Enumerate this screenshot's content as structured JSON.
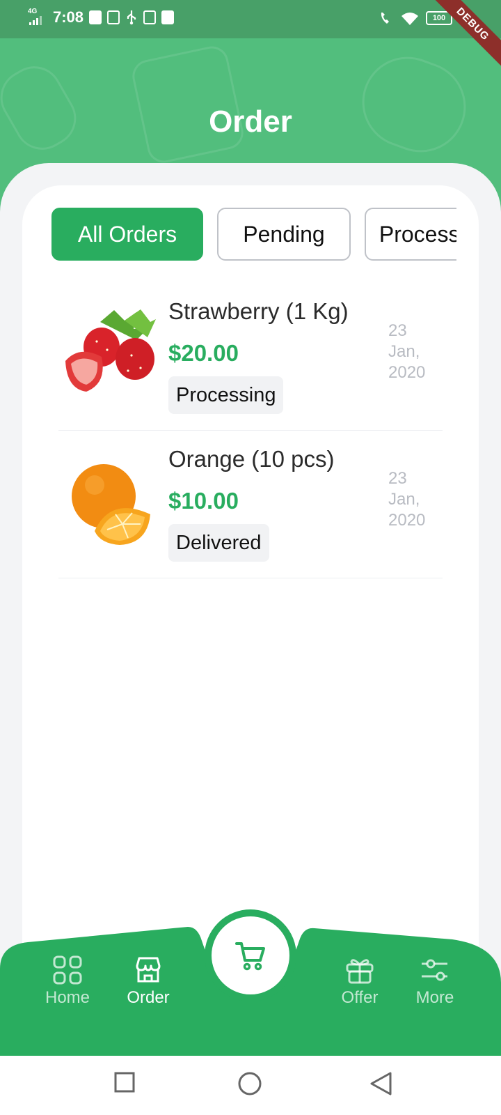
{
  "status_bar": {
    "network": "4G",
    "time": "7:08",
    "battery": "100",
    "debug_label": "DEBUG"
  },
  "header": {
    "title": "Order"
  },
  "tabs": [
    {
      "label": "All Orders",
      "active": true
    },
    {
      "label": "Pending",
      "active": false
    },
    {
      "label": "Processing",
      "active": false
    }
  ],
  "orders": [
    {
      "name": "Strawberry (1 Kg)",
      "price": "$20.00",
      "status": "Processing",
      "date": "23 Jan, 2020",
      "icon": "strawberry"
    },
    {
      "name": "Orange (10 pcs)",
      "price": "$10.00",
      "status": "Delivered",
      "date": "23 Jan, 2020",
      "icon": "orange"
    }
  ],
  "bottom_nav": {
    "items": [
      {
        "label": "Home",
        "icon": "grid-icon",
        "active": false
      },
      {
        "label": "Order",
        "icon": "store-icon",
        "active": true
      },
      {
        "label": "Offer",
        "icon": "gift-icon",
        "active": false
      },
      {
        "label": "More",
        "icon": "sliders-icon",
        "active": false
      }
    ],
    "center_icon": "cart-icon"
  },
  "colors": {
    "primary": "#29ad5f",
    "header_bg": "#52be7d",
    "status_bar_bg": "#48a068",
    "sheet_bg": "#f3f4f6",
    "debug_ribbon": "#8d2f2a"
  }
}
